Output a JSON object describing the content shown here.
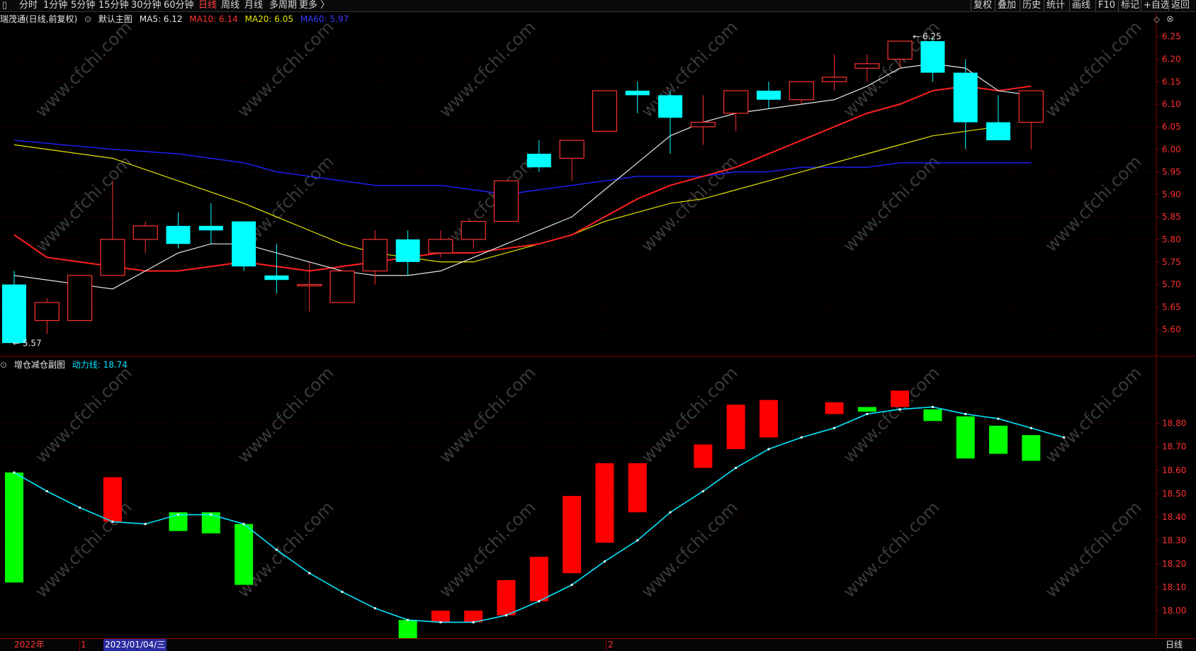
{
  "toolbar": {
    "periods": [
      "分时",
      "1分钟",
      "5分钟",
      "15分钟",
      "30分钟",
      "60分钟",
      "日线",
      "周线",
      "月线",
      "多周期",
      "更多 〉"
    ],
    "active_period": "日线",
    "right_items": [
      "复权",
      "叠加",
      "历史",
      "统计",
      "画线",
      "F10",
      "标记",
      "+自选",
      "返回"
    ]
  },
  "main_info": {
    "title": "瑞茂通(日线,前复权)",
    "template": "默认主图",
    "ma5": "MA5: 6.12",
    "ma10": "MA10: 6.14",
    "ma20": "MA20: 6.05",
    "ma60": "MA60: 5.97"
  },
  "sub_info": {
    "title": "增仓减仓副图",
    "line": "动力线: 18.74"
  },
  "bottom": {
    "labels": [
      "2022年",
      "1",
      "2023/01/04/三",
      "2"
    ],
    "right": "日线"
  },
  "colors": {
    "up": "#ff3232",
    "down": "#00ffff",
    "ma5": "#e6e6e6",
    "ma10": "#ff2020",
    "ma20": "#e6e600",
    "ma60": "#2020ff",
    "power_line": "#00e5ff",
    "bar_up": "#ff0000",
    "bar_down": "#00ff00",
    "grid": "#5a0000"
  },
  "watermark": "www.cfchi.com",
  "chart_data": [
    {
      "type": "candlestick",
      "ylim": [
        5.55,
        6.27
      ],
      "yticks": [
        "6.25",
        "6.20",
        "6.15",
        "6.10",
        "6.05",
        "6.00",
        "5.95",
        "5.90",
        "5.85",
        "5.80",
        "5.75",
        "5.70",
        "5.65",
        "5.60"
      ],
      "high_label": "6.25",
      "low_label": "5.57",
      "candles": [
        {
          "o": 5.7,
          "h": 5.73,
          "l": 5.57,
          "c": 5.57
        },
        {
          "o": 5.62,
          "h": 5.67,
          "l": 5.59,
          "c": 5.66
        },
        {
          "o": 5.62,
          "h": 5.72,
          "l": 5.62,
          "c": 5.72
        },
        {
          "o": 5.72,
          "h": 5.93,
          "l": 5.72,
          "c": 5.8
        },
        {
          "o": 5.8,
          "h": 5.84,
          "l": 5.77,
          "c": 5.83
        },
        {
          "o": 5.83,
          "h": 5.86,
          "l": 5.78,
          "c": 5.79
        },
        {
          "o": 5.83,
          "h": 5.88,
          "l": 5.79,
          "c": 5.82
        },
        {
          "o": 5.84,
          "h": 5.84,
          "l": 5.73,
          "c": 5.74
        },
        {
          "o": 5.72,
          "h": 5.79,
          "l": 5.68,
          "c": 5.71
        },
        {
          "o": 5.7,
          "h": 5.75,
          "l": 5.64,
          "c": 5.7
        },
        {
          "o": 5.66,
          "h": 5.73,
          "l": 5.66,
          "c": 5.73
        },
        {
          "o": 5.73,
          "h": 5.82,
          "l": 5.7,
          "c": 5.8
        },
        {
          "o": 5.8,
          "h": 5.82,
          "l": 5.72,
          "c": 5.75
        },
        {
          "o": 5.77,
          "h": 5.82,
          "l": 5.76,
          "c": 5.8
        },
        {
          "o": 5.8,
          "h": 5.84,
          "l": 5.78,
          "c": 5.84
        },
        {
          "o": 5.84,
          "h": 5.93,
          "l": 5.84,
          "c": 5.93
        },
        {
          "o": 5.99,
          "h": 6.02,
          "l": 5.95,
          "c": 5.96
        },
        {
          "o": 5.98,
          "h": 6.02,
          "l": 5.93,
          "c": 6.02
        },
        {
          "o": 6.04,
          "h": 6.13,
          "l": 6.04,
          "c": 6.13
        },
        {
          "o": 6.13,
          "h": 6.15,
          "l": 6.08,
          "c": 6.12
        },
        {
          "o": 6.12,
          "h": 6.13,
          "l": 5.99,
          "c": 6.07
        },
        {
          "o": 6.05,
          "h": 6.12,
          "l": 6.01,
          "c": 6.06
        },
        {
          "o": 6.08,
          "h": 6.13,
          "l": 6.04,
          "c": 6.13
        },
        {
          "o": 6.13,
          "h": 6.15,
          "l": 6.09,
          "c": 6.11
        },
        {
          "o": 6.11,
          "h": 6.15,
          "l": 6.1,
          "c": 6.15
        },
        {
          "o": 6.15,
          "h": 6.21,
          "l": 6.13,
          "c": 6.16
        },
        {
          "o": 6.18,
          "h": 6.21,
          "l": 6.15,
          "c": 6.19
        },
        {
          "o": 6.2,
          "h": 6.24,
          "l": 6.18,
          "c": 6.24
        },
        {
          "o": 6.24,
          "h": 6.25,
          "l": 6.15,
          "c": 6.17
        },
        {
          "o": 6.17,
          "h": 6.2,
          "l": 6.0,
          "c": 6.06
        },
        {
          "o": 6.06,
          "h": 6.12,
          "l": 6.02,
          "c": 6.02
        },
        {
          "o": 6.06,
          "h": 6.13,
          "l": 6.0,
          "c": 6.13
        }
      ],
      "ma5": [
        5.72,
        5.71,
        5.7,
        5.69,
        5.73,
        5.77,
        5.79,
        5.79,
        5.77,
        5.75,
        5.73,
        5.72,
        5.72,
        5.73,
        5.76,
        5.79,
        5.82,
        5.85,
        5.91,
        5.97,
        6.03,
        6.06,
        6.08,
        6.09,
        6.1,
        6.11,
        6.14,
        6.18,
        6.19,
        6.18,
        6.13,
        6.12
      ],
      "ma10": [
        5.81,
        5.76,
        5.75,
        5.74,
        5.73,
        5.73,
        5.74,
        5.75,
        5.74,
        5.73,
        5.74,
        5.75,
        5.76,
        5.77,
        5.77,
        5.78,
        5.79,
        5.81,
        5.85,
        5.89,
        5.92,
        5.94,
        5.96,
        5.99,
        6.02,
        6.05,
        6.08,
        6.1,
        6.13,
        6.14,
        6.13,
        6.14
      ],
      "ma20": [
        6.01,
        null,
        null,
        5.98,
        null,
        5.93,
        null,
        5.88,
        5.85,
        5.82,
        5.79,
        5.77,
        5.76,
        5.75,
        5.75,
        5.77,
        5.79,
        5.81,
        5.84,
        5.86,
        5.88,
        5.89,
        5.91,
        5.93,
        5.95,
        5.97,
        5.99,
        6.01,
        6.03,
        6.04,
        6.05
      ],
      "ma60": [
        6.02,
        null,
        null,
        6.0,
        null,
        5.99,
        null,
        5.97,
        5.95,
        5.94,
        5.93,
        5.92,
        5.92,
        5.92,
        5.91,
        5.9,
        5.91,
        5.92,
        5.93,
        5.94,
        5.94,
        5.94,
        5.95,
        5.95,
        5.96,
        5.96,
        5.96,
        5.97,
        5.97,
        5.97,
        5.97,
        5.97
      ]
    },
    {
      "type": "bar",
      "ylim": [
        17.9,
        19.02
      ],
      "yticks": [
        "18.80",
        "18.70",
        "18.60",
        "18.50",
        "18.40",
        "18.30",
        "18.20",
        "18.10",
        "18.00"
      ],
      "power_line": [
        18.59,
        18.51,
        18.44,
        18.38,
        18.37,
        18.41,
        18.41,
        18.37,
        18.26,
        18.16,
        18.08,
        18.01,
        17.96,
        17.95,
        17.95,
        17.98,
        18.04,
        18.11,
        18.21,
        18.3,
        18.42,
        18.51,
        18.61,
        18.69,
        18.74,
        18.78,
        18.84,
        18.86,
        18.87,
        18.84,
        18.82,
        18.78,
        18.74
      ],
      "bars": [
        {
          "x": 0,
          "from": 18.59,
          "to": 18.12,
          "dir": "down"
        },
        {
          "x": 3,
          "from": 18.57,
          "to": 18.38,
          "dir": "up"
        },
        {
          "x": 5,
          "from": 18.42,
          "to": 18.34,
          "dir": "down"
        },
        {
          "x": 6,
          "from": 18.42,
          "to": 18.33,
          "dir": "down"
        },
        {
          "x": 7,
          "from": 18.37,
          "to": 18.11,
          "dir": "down"
        },
        {
          "x": 12,
          "from": 17.96,
          "to": 17.83,
          "dir": "down"
        },
        {
          "x": 13,
          "from": 17.95,
          "to": 18.0,
          "dir": "up"
        },
        {
          "x": 14,
          "from": 17.95,
          "to": 18.0,
          "dir": "up"
        },
        {
          "x": 15,
          "from": 17.98,
          "to": 18.13,
          "dir": "up"
        },
        {
          "x": 16,
          "from": 18.04,
          "to": 18.23,
          "dir": "up"
        },
        {
          "x": 17,
          "from": 18.16,
          "to": 18.49,
          "dir": "up"
        },
        {
          "x": 18,
          "from": 18.29,
          "to": 18.63,
          "dir": "up"
        },
        {
          "x": 19,
          "from": 18.42,
          "to": 18.63,
          "dir": "up"
        },
        {
          "x": 21,
          "from": 18.61,
          "to": 18.71,
          "dir": "up"
        },
        {
          "x": 22,
          "from": 18.69,
          "to": 18.88,
          "dir": "up"
        },
        {
          "x": 23,
          "from": 18.74,
          "to": 18.9,
          "dir": "up"
        },
        {
          "x": 25,
          "from": 18.84,
          "to": 18.89,
          "dir": "up"
        },
        {
          "x": 26,
          "from": 18.87,
          "to": 18.85,
          "dir": "down"
        },
        {
          "x": 27,
          "from": 18.87,
          "to": 18.94,
          "dir": "up"
        },
        {
          "x": 28,
          "from": 18.86,
          "to": 18.81,
          "dir": "down"
        },
        {
          "x": 29,
          "from": 18.83,
          "to": 18.65,
          "dir": "down"
        },
        {
          "x": 30,
          "from": 18.79,
          "to": 18.67,
          "dir": "down"
        },
        {
          "x": 31,
          "from": 18.75,
          "to": 18.64,
          "dir": "down"
        }
      ]
    }
  ]
}
